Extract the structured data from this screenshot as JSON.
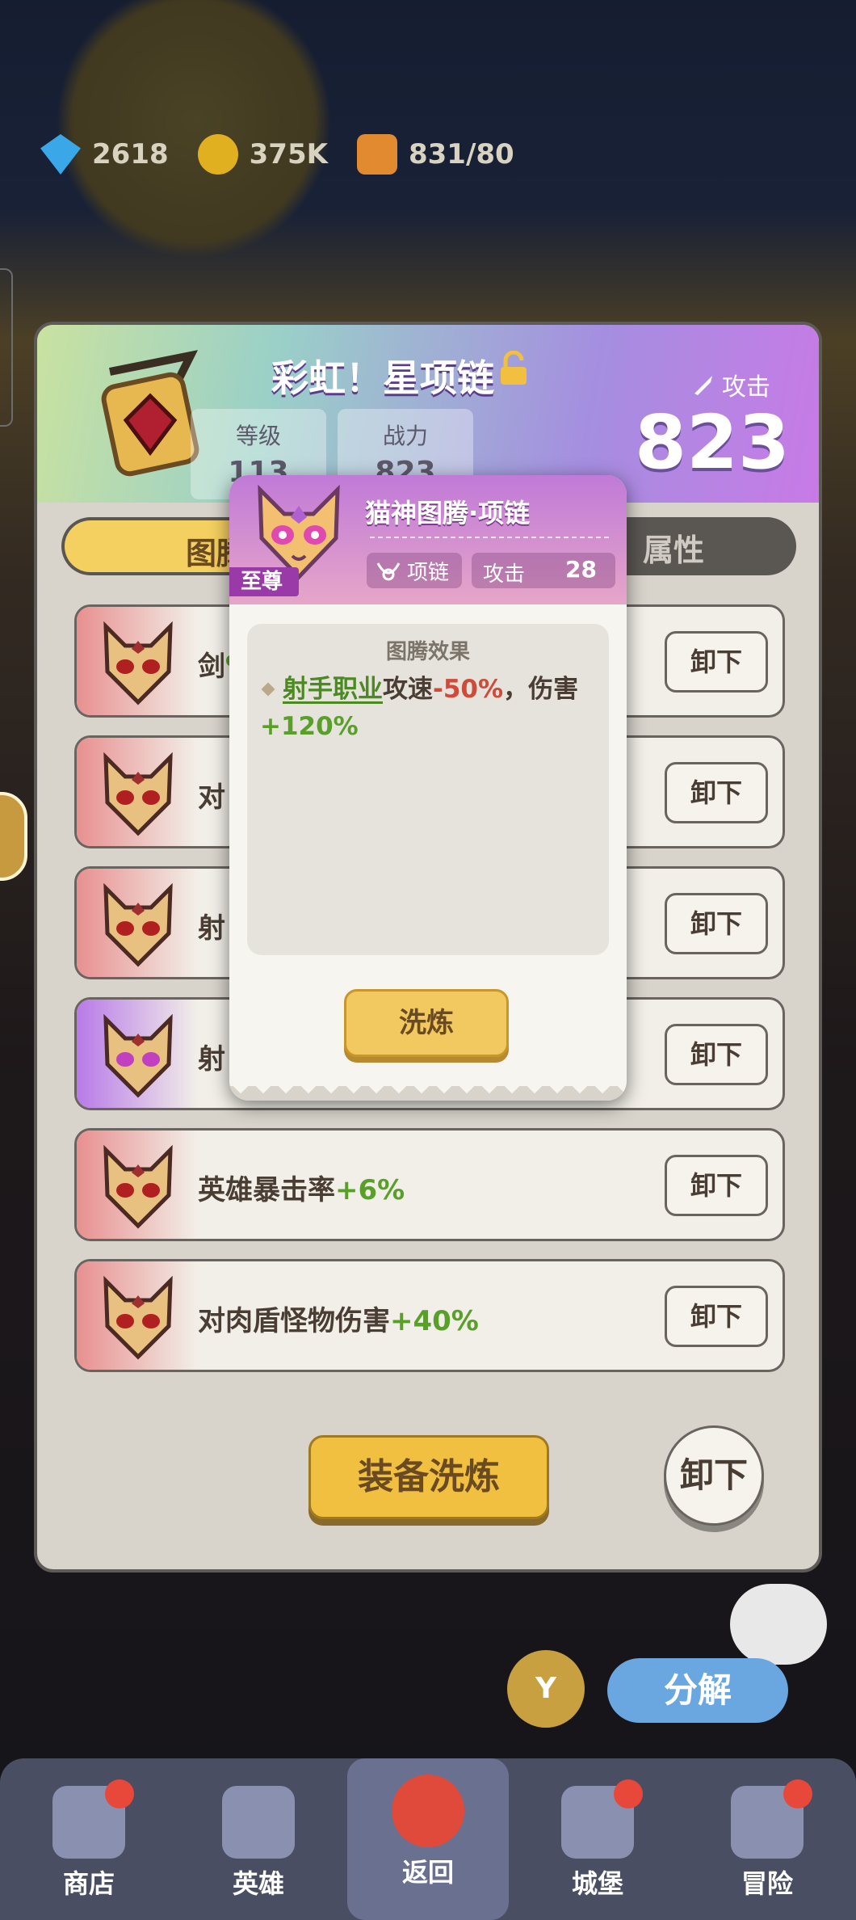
{
  "resources": [
    {
      "icon": "gem-icon",
      "value": "2618"
    },
    {
      "icon": "coin-icon",
      "value": "375K"
    },
    {
      "icon": "stamina-icon",
      "value": "831/80"
    }
  ],
  "panel": {
    "title": "彩虹！星项链",
    "level_label": "等级",
    "level_value": "113",
    "power_label": "战力",
    "power_value": "823",
    "attack_label": "攻击",
    "attack_value": "823",
    "tab_left": "图腾",
    "tab_right": "属性"
  },
  "rows": [
    {
      "prefix": "剑",
      "bonus": "%",
      "button": "卸下",
      "rarity": "red"
    },
    {
      "prefix": "对",
      "bonus": "",
      "button": "卸下",
      "rarity": "red"
    },
    {
      "prefix": "射",
      "bonus": "",
      "button": "卸下",
      "rarity": "red"
    },
    {
      "prefix": "射",
      "bonus": "",
      "button": "卸下",
      "rarity": "purple"
    },
    {
      "prefix": "英雄暴击率",
      "bonus": "+6%",
      "button": "卸下",
      "rarity": "red"
    },
    {
      "prefix": "对肉盾怪物伤害",
      "bonus": "+40%",
      "button": "卸下",
      "rarity": "red"
    }
  ],
  "refine_equipment_label": "装备洗炼",
  "unequip_label": "卸下",
  "y_button_label": "Y",
  "split_label": "分解",
  "bottom_nav": [
    {
      "label": "商店",
      "icon": "shop-icon",
      "badge": true
    },
    {
      "label": "英雄",
      "icon": "hero-icon",
      "badge": false
    },
    {
      "label": "返回",
      "icon": "close-icon",
      "badge": false,
      "active": true
    },
    {
      "label": "城堡",
      "icon": "castle-icon",
      "badge": true
    },
    {
      "label": "冒险",
      "icon": "planet-icon",
      "badge": true
    }
  ],
  "popup": {
    "title": "猫神图腾·项链",
    "rarity": "至尊",
    "type_label": "项链",
    "attack_label": "攻击",
    "attack_value": "28",
    "effect_title": "图腾效果",
    "effect": {
      "class_link": "射手职业",
      "part1": "攻速",
      "value1": "-50%",
      "part2": "，伤害",
      "value2": "+120%"
    },
    "refine_label": "洗炼"
  },
  "colors": {
    "popup_header": "#c07ad8",
    "refine_button": "#f2c860",
    "positive": "#58a028",
    "negative": "#d04a3a"
  }
}
